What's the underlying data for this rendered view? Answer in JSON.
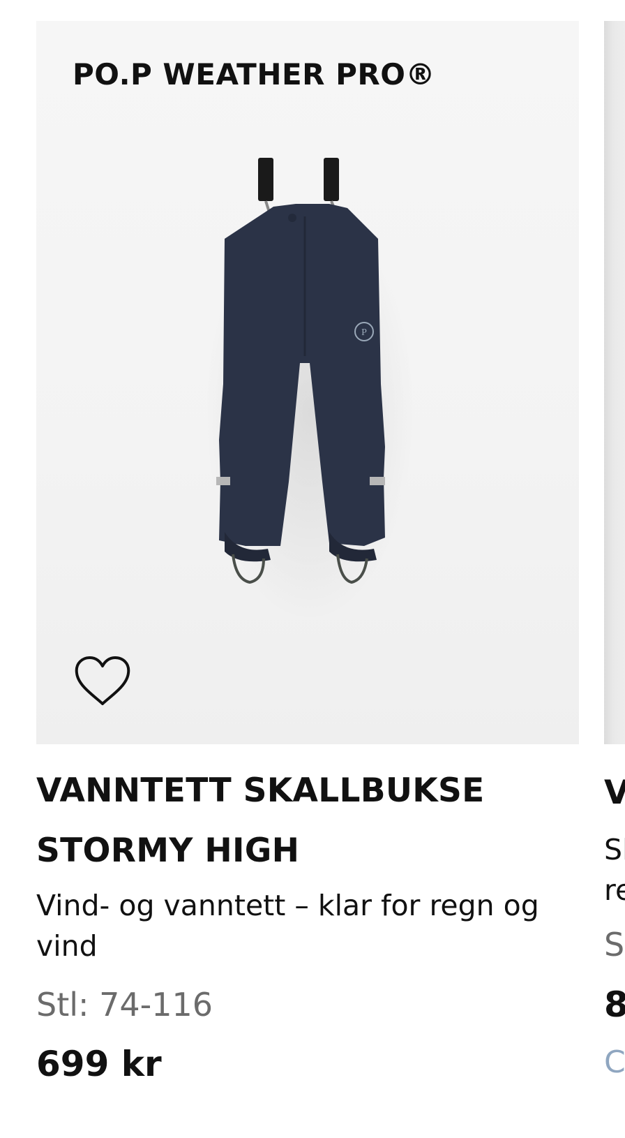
{
  "product": {
    "brand_label": "PO.P WEATHER PRO®",
    "name_line1": "VANNTETT SKALLBUKSE",
    "name_line2": "STORMY HIGH",
    "description": "Vind- og vanntett – klar for regn og vind",
    "sizes": "Stl: 74-116",
    "price": "699 kr",
    "wishlist_icon": "heart-outline-icon",
    "color": "#2b3347"
  },
  "next_product": {
    "title_partial": "V",
    "desc_line1_partial": "Sl",
    "desc_line2_partial": "re",
    "sizes_partial": "S",
    "price_partial": "8",
    "swatch_partial": "C"
  }
}
